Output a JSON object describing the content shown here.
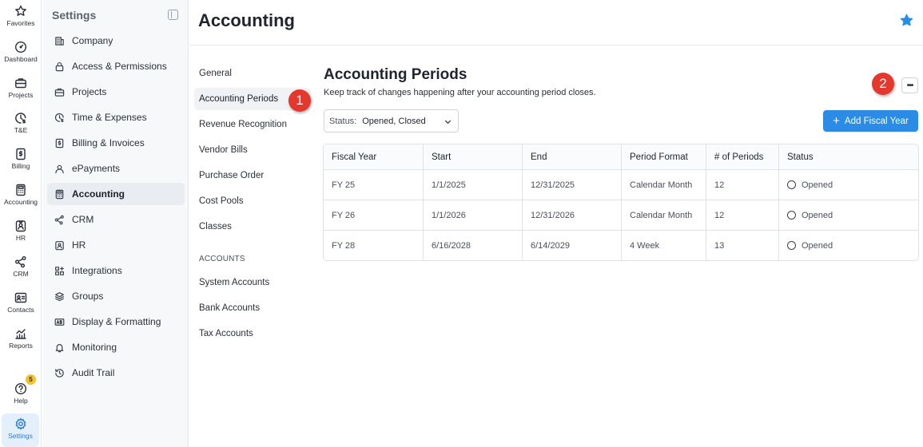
{
  "rail": {
    "items": [
      {
        "label": "Favorites",
        "icon": "star-icon"
      },
      {
        "label": "Dashboard",
        "icon": "gauge-icon"
      },
      {
        "label": "Projects",
        "icon": "briefcase-icon"
      },
      {
        "label": "T&E",
        "icon": "clock-dollar-icon"
      },
      {
        "label": "Billing",
        "icon": "billing-icon"
      },
      {
        "label": "Accounting",
        "icon": "calculator-icon"
      },
      {
        "label": "HR",
        "icon": "id-badge-icon"
      },
      {
        "label": "CRM",
        "icon": "network-icon"
      },
      {
        "label": "Contacts",
        "icon": "contact-card-icon"
      },
      {
        "label": "Reports",
        "icon": "chart-icon"
      },
      {
        "label": "Help",
        "icon": "help-icon",
        "badge": "5"
      },
      {
        "label": "Settings",
        "icon": "gear-icon"
      }
    ]
  },
  "settings": {
    "title": "Settings",
    "items": [
      {
        "label": "Company",
        "icon": "building-icon"
      },
      {
        "label": "Access & Permissions",
        "icon": "lock-icon"
      },
      {
        "label": "Projects",
        "icon": "briefcase-icon"
      },
      {
        "label": "Time & Expenses",
        "icon": "clock-dollar-icon"
      },
      {
        "label": "Billing & Invoices",
        "icon": "billing-icon"
      },
      {
        "label": "ePayments",
        "icon": "payment-icon"
      },
      {
        "label": "Accounting",
        "icon": "calculator-icon"
      },
      {
        "label": "CRM",
        "icon": "network-icon"
      },
      {
        "label": "HR",
        "icon": "id-badge-icon"
      },
      {
        "label": "Integrations",
        "icon": "integrations-icon"
      },
      {
        "label": "Groups",
        "icon": "layers-icon"
      },
      {
        "label": "Display & Formatting",
        "icon": "display-icon"
      },
      {
        "label": "Monitoring",
        "icon": "bell-icon"
      },
      {
        "label": "Audit Trail",
        "icon": "history-icon"
      }
    ]
  },
  "header": {
    "title": "Accounting"
  },
  "subnav": {
    "items": [
      "General",
      "Accounting Periods",
      "Revenue Recognition",
      "Vendor Bills",
      "Purchase Order",
      "Cost Pools",
      "Classes"
    ],
    "accounts_heading": "ACCOUNTS",
    "accounts_items": [
      "System Accounts",
      "Bank Accounts",
      "Tax Accounts"
    ]
  },
  "callouts": {
    "one": "1",
    "two": "2"
  },
  "main": {
    "title": "Accounting Periods",
    "description": "Keep track of changes happening after your accounting period closes.",
    "more_label": "•••",
    "status_filter": {
      "label": "Status:",
      "value": "Opened, Closed"
    },
    "add_button": "Add Fiscal Year"
  },
  "table": {
    "headers": [
      "Fiscal Year",
      "Start",
      "End",
      "Period Format",
      "# of Periods",
      "Status"
    ],
    "rows": [
      [
        "FY 25",
        "1/1/2025",
        "12/31/2025",
        "Calendar Month",
        "12",
        "Opened"
      ],
      [
        "FY 26",
        "1/1/2026",
        "12/31/2026",
        "Calendar Month",
        "12",
        "Opened"
      ],
      [
        "FY 28",
        "6/16/2028",
        "6/14/2029",
        "4 Week",
        "13",
        "Opened"
      ]
    ]
  },
  "colors": {
    "accent": "#2b8ce6",
    "callout": "#e4372d",
    "badge": "#f2c233"
  }
}
